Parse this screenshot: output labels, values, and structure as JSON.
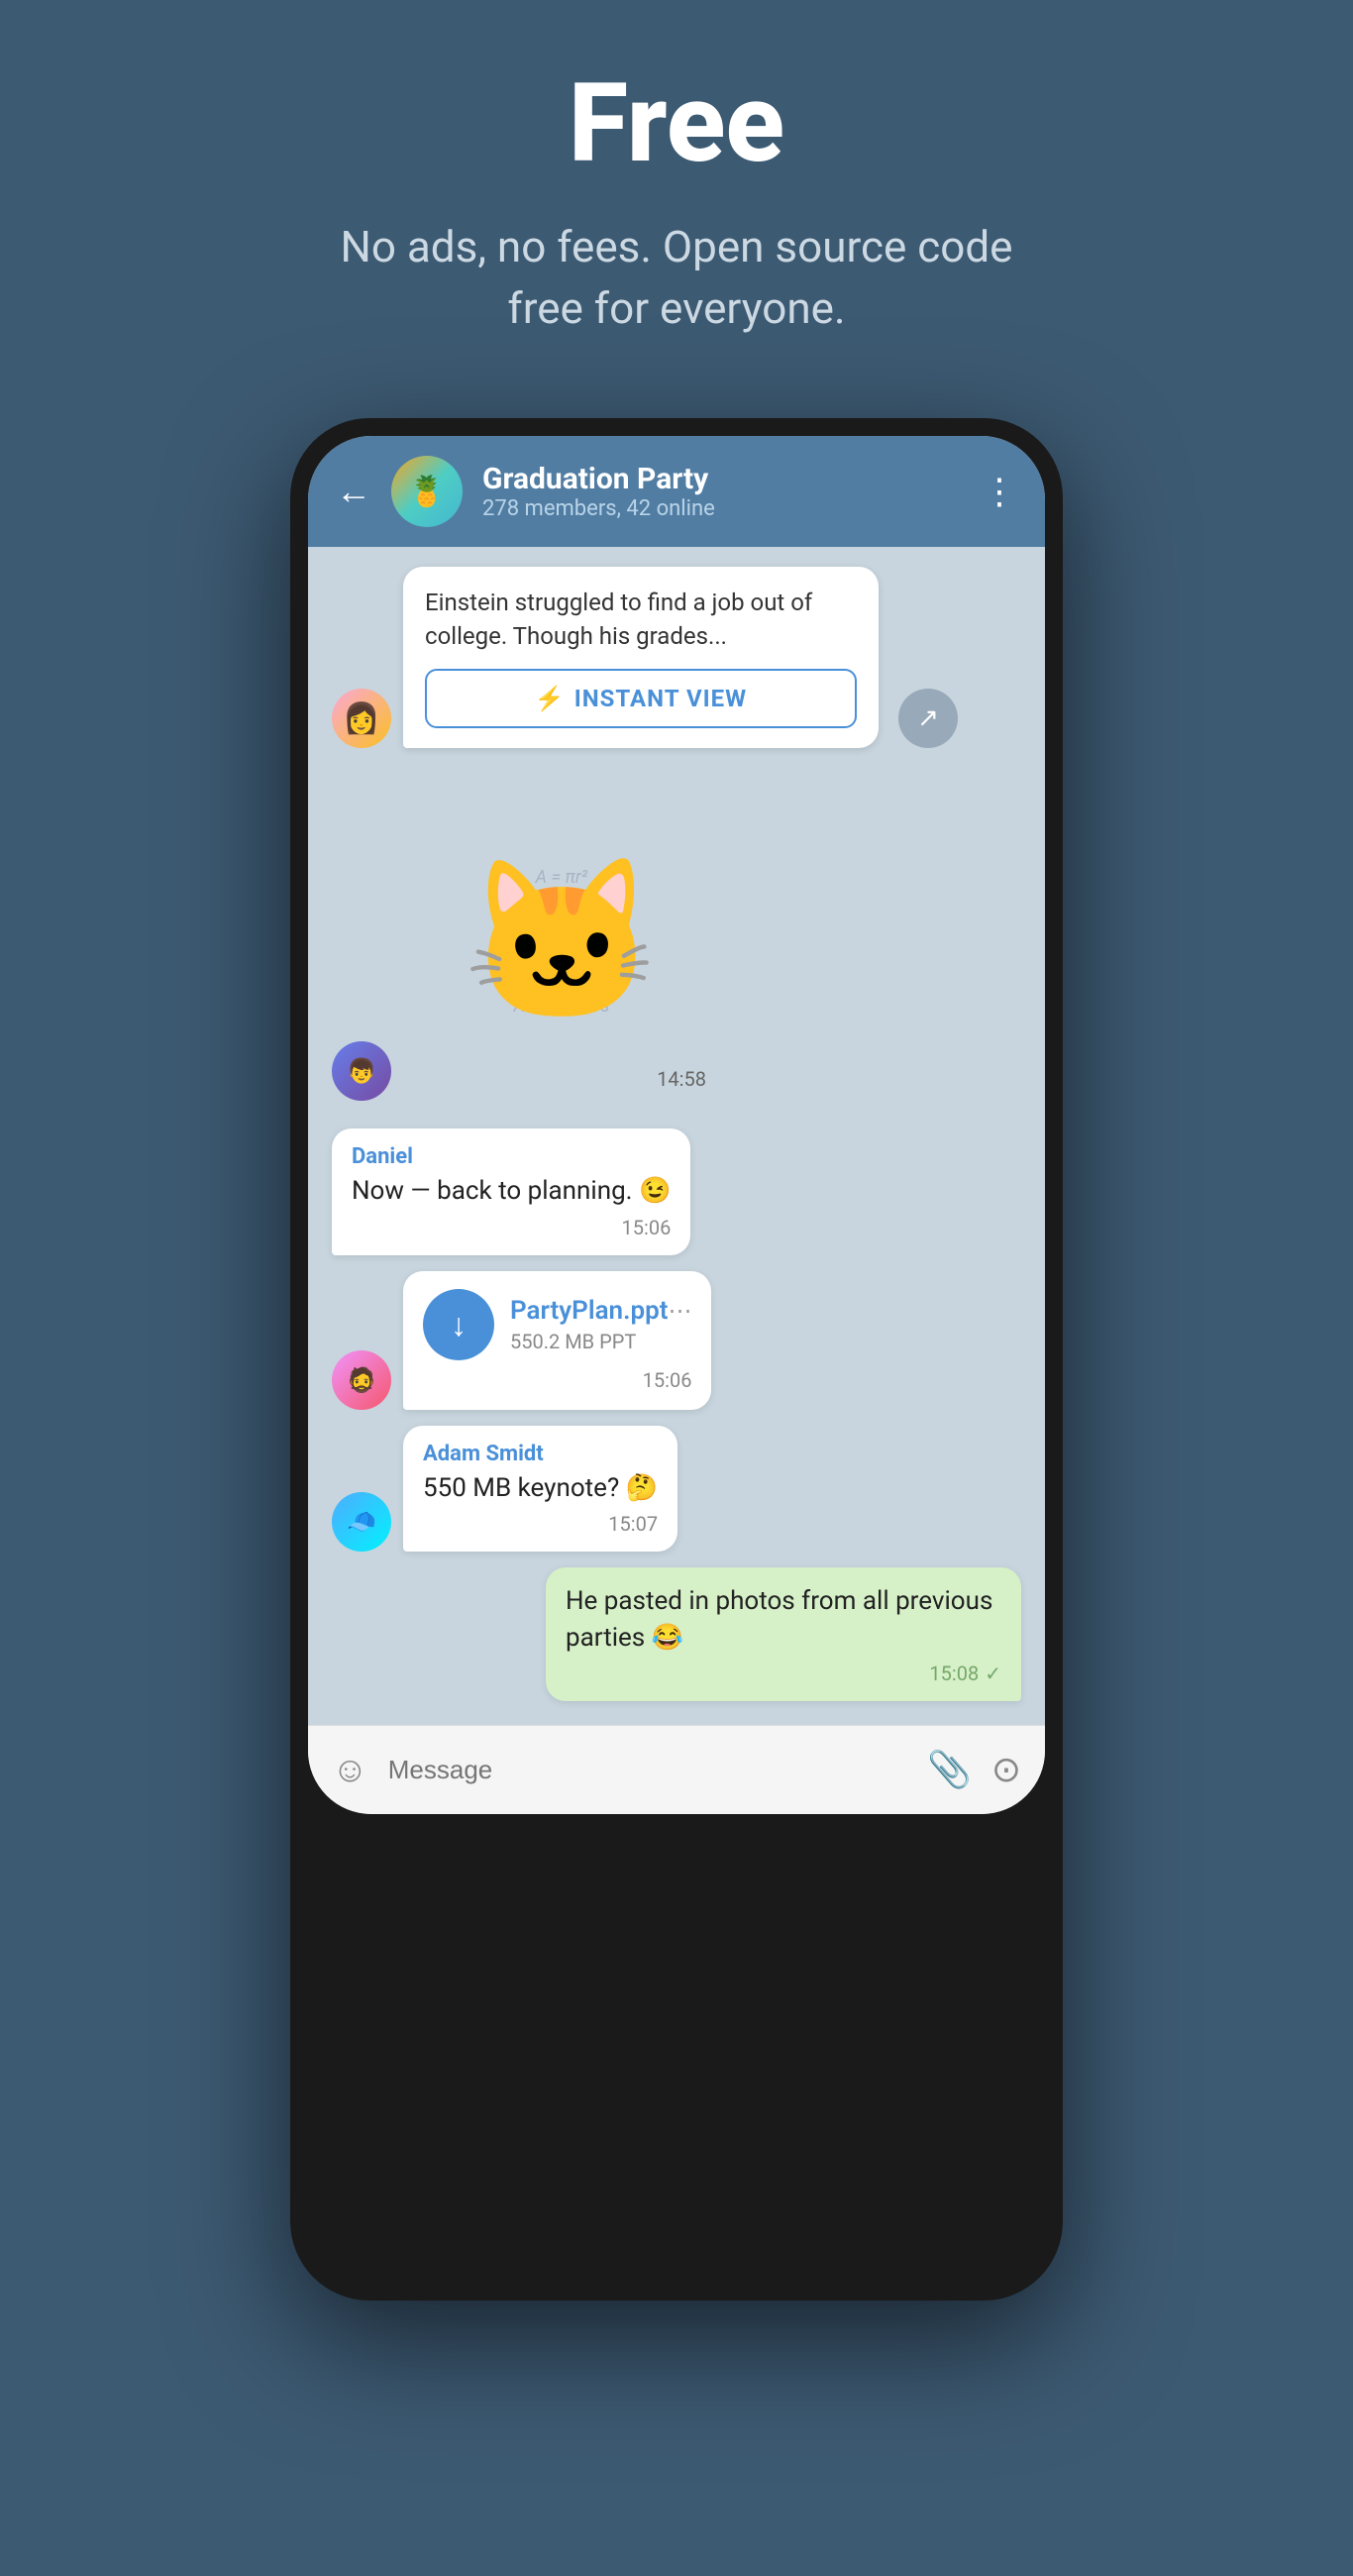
{
  "hero": {
    "title": "Free",
    "subtitle": "No ads, no fees. Open source code free for everyone."
  },
  "chat": {
    "header": {
      "back_label": "←",
      "group_name": "Graduation Party",
      "group_status": "278 members, 42 online",
      "menu_icon": "⋮"
    },
    "messages": [
      {
        "id": "article-msg",
        "type": "article",
        "avatar": "female",
        "text": "Einstein struggled to find a job out of college. Though his grades...",
        "instant_view_label": "INSTANT VIEW",
        "instant_view_icon": "⚡"
      },
      {
        "id": "sticker-msg",
        "type": "sticker",
        "avatar": "male1",
        "emoji": "🐱",
        "time": "14:58"
      },
      {
        "id": "daniel-msg",
        "type": "text",
        "sender": "Daniel",
        "text": "Now — back to planning. 😉",
        "time": "15:06"
      },
      {
        "id": "file-msg",
        "type": "file",
        "avatar": "male2",
        "file_name": "PartyPlan.ppt",
        "file_size": "550.2 MB PPT",
        "time": "15:06"
      },
      {
        "id": "adam-msg",
        "type": "text",
        "sender": "Adam Smidt",
        "avatar": "male3",
        "text": "550 MB keynote? 🤔",
        "time": "15:07"
      },
      {
        "id": "outgoing-msg",
        "type": "outgoing",
        "text": "He pasted in photos from all previous parties 😂",
        "time": "15:08",
        "read": true
      }
    ],
    "input": {
      "placeholder": "Message",
      "emoji_icon": "☺",
      "attach_icon": "📎",
      "camera_icon": "⊙"
    }
  }
}
